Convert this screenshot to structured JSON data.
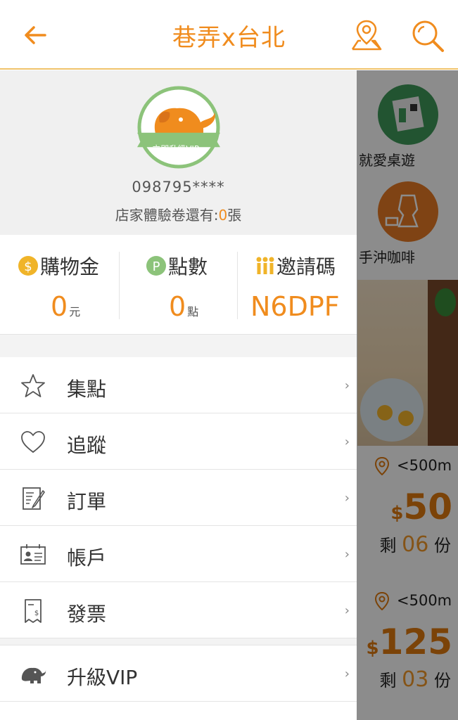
{
  "header": {
    "title": "巷弄x台北",
    "accent_color": "#f08c1e",
    "back_icon": "arrow-left-icon",
    "map_icon": "map-pin-icon",
    "search_icon": "search-icon"
  },
  "background": {
    "categories": [
      {
        "label": "就愛桌遊",
        "icon": "board-game-icon",
        "color": "#3f9a5a"
      },
      {
        "label": "手沖咖啡",
        "icon": "coffee-pot-icon",
        "color": "#e87a25"
      }
    ],
    "deals": [
      {
        "distance": "<500m",
        "currency": "$",
        "price": "50",
        "remain_prefix": "剩",
        "remain_count": "06",
        "remain_suffix": "份"
      },
      {
        "distance": "<500m",
        "currency": "$",
        "price": "125",
        "remain_prefix": "剩",
        "remain_count": "03",
        "remain_suffix": "份"
      }
    ]
  },
  "profile": {
    "badge_text": "立即升級VIP ›",
    "phone": "098795****",
    "voucher_prefix": "店家體驗卷還有:",
    "voucher_count": "0",
    "voucher_suffix": "張"
  },
  "stats": {
    "credit": {
      "label": "購物金",
      "value": "0",
      "unit": "元",
      "icon": "dollar-coin-icon"
    },
    "points": {
      "label": "點數",
      "value": "0",
      "unit": "點",
      "icon": "points-coin-icon"
    },
    "invite": {
      "label": "邀請碼",
      "value": "N6DPF",
      "icon": "people-icon"
    }
  },
  "menu": [
    {
      "label": "集點",
      "icon": "star-icon",
      "chevron": "›"
    },
    {
      "label": "追蹤",
      "icon": "heart-icon",
      "chevron": "›"
    },
    {
      "label": "訂單",
      "icon": "order-document-icon",
      "chevron": "›"
    },
    {
      "label": "帳戶",
      "icon": "account-card-icon",
      "chevron": "›"
    },
    {
      "label": "發票",
      "icon": "receipt-icon",
      "chevron": "›"
    },
    {
      "label": "升級VIP",
      "icon": "elephant-icon",
      "chevron": "›"
    }
  ]
}
